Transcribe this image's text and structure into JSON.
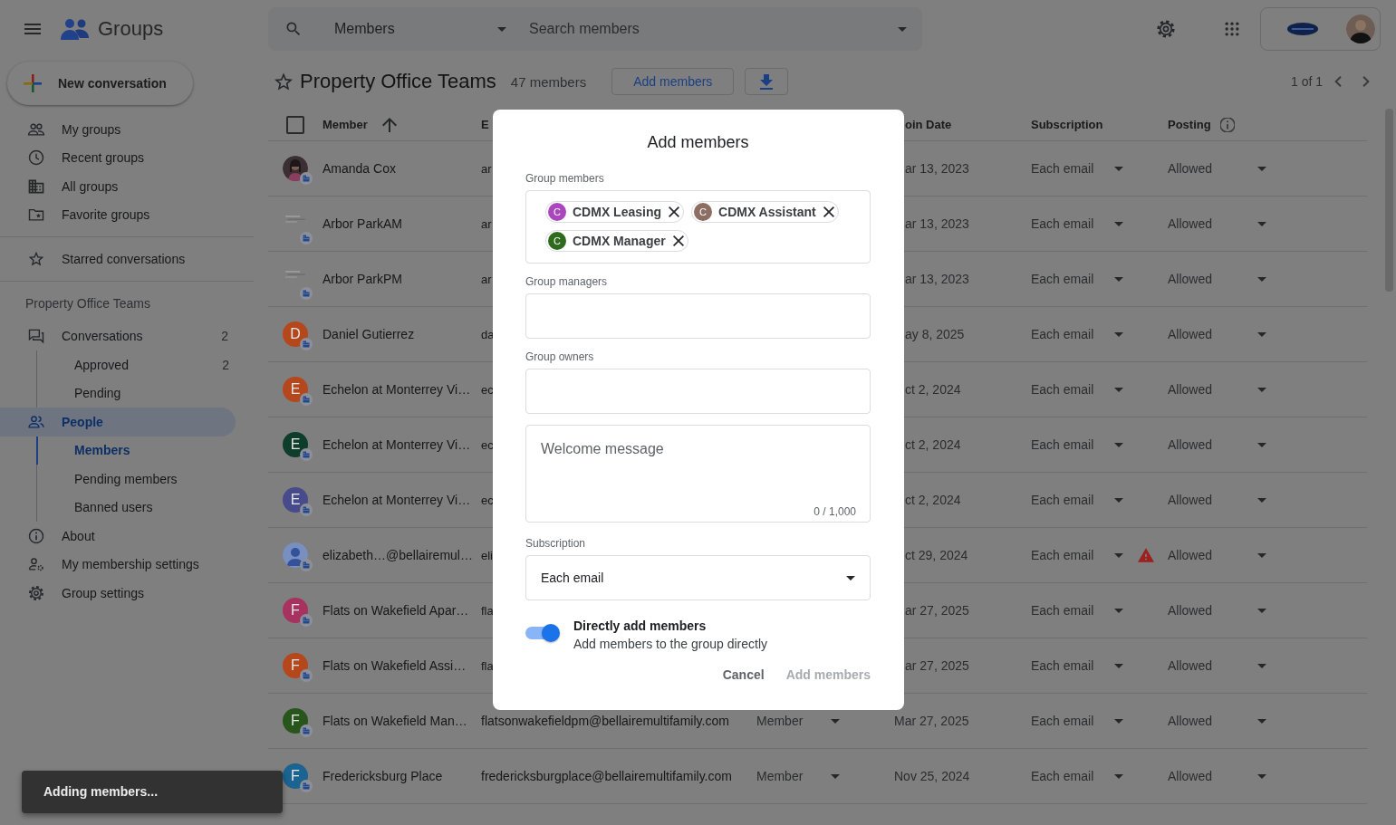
{
  "topbar": {
    "app_name": "Groups",
    "search": {
      "scope": "Members",
      "placeholder": "Search members"
    }
  },
  "sidebar": {
    "new_conversation": "New conversation",
    "nav": [
      {
        "label": "My groups"
      },
      {
        "label": "Recent groups"
      },
      {
        "label": "All groups"
      },
      {
        "label": "Favorite groups"
      }
    ],
    "starred": {
      "label": "Starred conversations"
    },
    "group_heading": "Property Office Teams",
    "group_nav": [
      {
        "label": "Conversations",
        "count": "2",
        "selected": false,
        "children": [
          {
            "label": "Approved",
            "count": "2",
            "selected": false
          },
          {
            "label": "Pending",
            "selected": false
          }
        ]
      },
      {
        "label": "People",
        "selected": true,
        "children": [
          {
            "label": "Members",
            "selected": true
          },
          {
            "label": "Pending members",
            "selected": false
          },
          {
            "label": "Banned users",
            "selected": false
          }
        ]
      },
      {
        "label": "About",
        "selected": false
      },
      {
        "label": "My membership settings",
        "selected": false
      },
      {
        "label": "Group settings",
        "selected": false
      }
    ]
  },
  "group_header": {
    "starred": false,
    "title": "Property Office Teams",
    "member_count": "47 members",
    "add_button": "Add members",
    "pager": "1 of 1"
  },
  "table": {
    "select_all": {
      "checked": false
    },
    "columns": [
      {
        "label": "Member",
        "sorted": true
      },
      {
        "label": "E"
      },
      {
        "label": "oin Date"
      },
      {
        "label": "Subscription"
      },
      {
        "label": "Posting",
        "info": true
      }
    ],
    "rows": [
      {
        "avatar": {
          "kind": "photo"
        },
        "name": "Amanda Cox",
        "email": "ar",
        "join_date": "ar 13, 2023",
        "subscription": "Each email",
        "warning": false,
        "posting": "Allowed"
      },
      {
        "avatar": {
          "kind": "logo"
        },
        "name": "Arbor ParkAM",
        "email": "ar",
        "join_date": "ar 13, 2023",
        "subscription": "Each email",
        "warning": false,
        "posting": "Allowed"
      },
      {
        "avatar": {
          "kind": "logo"
        },
        "name": "Arbor ParkPM",
        "email": "ar",
        "join_date": "ar 13, 2023",
        "subscription": "Each email",
        "warning": false,
        "posting": "Allowed"
      },
      {
        "avatar": {
          "kind": "letter",
          "initial": "D",
          "color": "#b5471d"
        },
        "name": "Daniel Gutierrez",
        "email": "da",
        "join_date": "ay 8, 2025",
        "subscription": "Each email",
        "warning": false,
        "posting": "Allowed"
      },
      {
        "avatar": {
          "kind": "letter",
          "initial": "E",
          "color": "#b5471d"
        },
        "name": "Echelon at Monterrey Vi…",
        "email": "ec",
        "join_date": "ct 2, 2024",
        "subscription": "Each email",
        "warning": false,
        "posting": "Allowed"
      },
      {
        "avatar": {
          "kind": "letter",
          "initial": "E",
          "color": "#0f3d2c"
        },
        "name": "Echelon at Monterrey Vi…",
        "email": "ec",
        "join_date": "ct 2, 2024",
        "subscription": "Each email",
        "warning": false,
        "posting": "Allowed"
      },
      {
        "avatar": {
          "kind": "letter",
          "initial": "E",
          "color": "#474b8c"
        },
        "name": "Echelon at Monterrey Vi…",
        "email": "ec",
        "join_date": "ct 2, 2024",
        "subscription": "Each email",
        "warning": false,
        "posting": "Allowed"
      },
      {
        "avatar": {
          "kind": "person"
        },
        "name": "elizabeth…@bellairemul…",
        "email": "eli",
        "join_date": "ct 29, 2024",
        "subscription": "Each email",
        "warning": true,
        "posting": "Allowed"
      },
      {
        "avatar": {
          "kind": "letter",
          "initial": "F",
          "color": "#a8325f"
        },
        "name": "Flats on Wakefield Apar…",
        "email": "fla",
        "join_date": "ar 27, 2025",
        "subscription": "Each email",
        "warning": false,
        "posting": "Allowed"
      },
      {
        "avatar": {
          "kind": "letter",
          "initial": "F",
          "color": "#b5471d"
        },
        "name": "Flats on Wakefield Assi…",
        "email": "fla",
        "join_date": "ar 27, 2025",
        "subscription": "Each email",
        "warning": false,
        "posting": "Allowed"
      },
      {
        "avatar": {
          "kind": "letter",
          "initial": "F",
          "color": "#27551c"
        },
        "name": "Flats on Wakefield Man…",
        "email": "flatsonwakefieldpm@bellairemultifamily.com",
        "role": "Member",
        "join_date": "Mar 27, 2025",
        "subscription": "Each email",
        "warning": false,
        "posting": "Allowed"
      },
      {
        "avatar": {
          "kind": "letter",
          "initial": "F",
          "color": "#1b6390"
        },
        "name": "Fredericksburg Place",
        "email": "fredericksburgplace@bellairemultifamily.com",
        "role": "Member",
        "join_date": "Nov 25, 2024",
        "subscription": "Each email",
        "warning": false,
        "posting": "Allowed"
      }
    ]
  },
  "dialog": {
    "title": "Add members",
    "fields": [
      {
        "kind": "chips",
        "label": "Group members",
        "chips": [
          {
            "initial": "C",
            "label": "CDMX Leasing",
            "color": "#ab47bc"
          },
          {
            "initial": "C",
            "label": "CDMX Assistant",
            "color": "#8d6e63"
          },
          {
            "initial": "C",
            "label": "CDMX Manager",
            "color": "#2e6b1f"
          }
        ]
      },
      {
        "kind": "text",
        "label": "Group managers"
      },
      {
        "kind": "text",
        "label": "Group owners"
      },
      {
        "kind": "textarea",
        "placeholder": "Welcome message",
        "counter": "0 / 1,000"
      },
      {
        "kind": "select",
        "label": "Subscription",
        "value": "Each email"
      }
    ],
    "toggle": {
      "label": "Directly add members",
      "description": "Add members to the group directly",
      "on": true
    },
    "buttons": [
      {
        "label": "Cancel",
        "disabled": false
      },
      {
        "label": "Add members",
        "disabled": true
      }
    ]
  },
  "toast": "Adding members..."
}
